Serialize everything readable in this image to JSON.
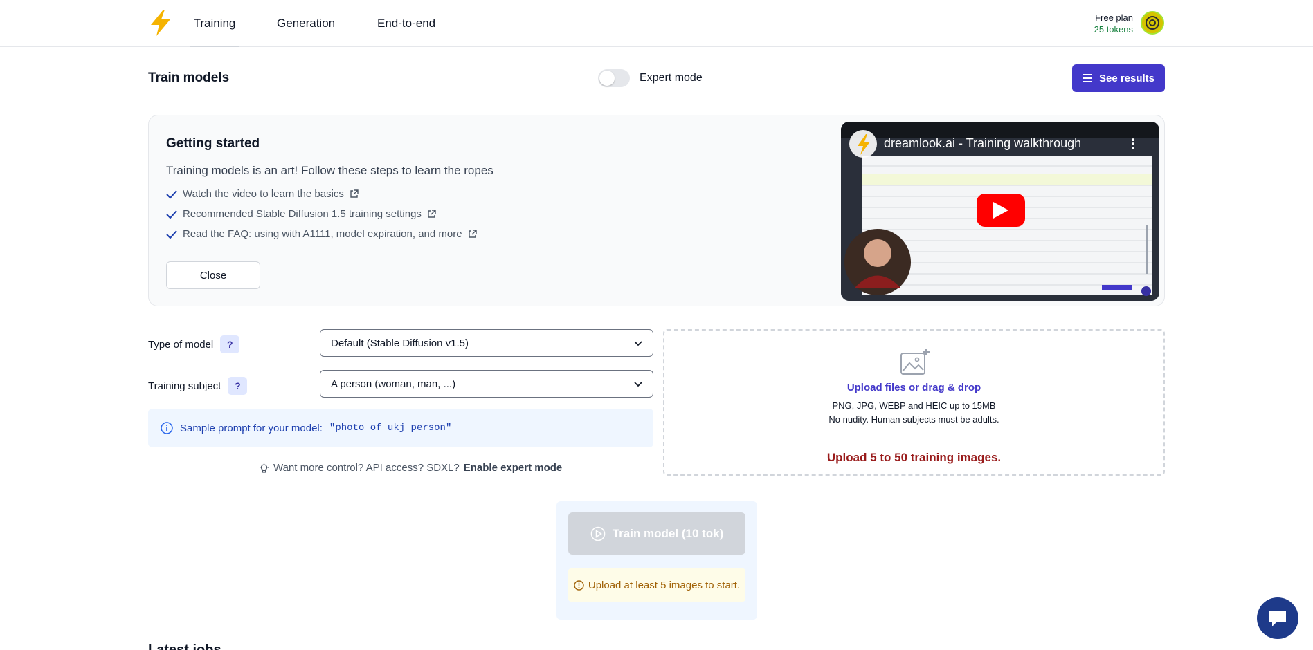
{
  "header": {
    "tabs": [
      {
        "label": "Training",
        "active": true
      },
      {
        "label": "Generation",
        "active": false
      },
      {
        "label": "End-to-end",
        "active": false
      }
    ],
    "plan_name": "Free plan",
    "plan_tokens": "25 tokens"
  },
  "page": {
    "title": "Train models",
    "expert_mode_label": "Expert mode",
    "expert_mode_on": false,
    "see_results_label": "See results"
  },
  "getting_started": {
    "title": "Getting started",
    "subtitle": "Training models is an art! Follow these steps to learn the ropes",
    "steps": [
      "Watch the video to learn the basics",
      "Recommended Stable Diffusion 1.5 training settings",
      "Read the FAQ: using with A1111, model expiration, and more"
    ],
    "close_label": "Close",
    "video_title": "dreamlook.ai - Training walkthrough"
  },
  "form": {
    "type_of_model_label": "Type of model",
    "type_of_model_value": "Default (Stable Diffusion v1.5)",
    "training_subject_label": "Training subject",
    "training_subject_value": "A person (woman, man, ...)",
    "help_label": "?",
    "sample_prompt_prefix": "Sample prompt for your model:",
    "sample_prompt": "\"photo of ukj person\"",
    "expert_hint": "Want more control? API access? SDXL?",
    "expert_hint_link": "Enable expert mode"
  },
  "upload": {
    "link_label": "Upload files or drag & drop",
    "formats": "PNG, JPG, WEBP and HEIC up to 15MB",
    "rule": "No nudity. Human subjects must be adults.",
    "requirement": "Upload 5 to 50 training images."
  },
  "train": {
    "button_label": "Train model (10 tok)",
    "warning": "Upload at least 5 images to start."
  },
  "latest_jobs_title": "Latest jobs",
  "colors": {
    "accent": "#4338ca",
    "error": "#991b1b",
    "warning": "#a16207",
    "tokens_green": "#15803d"
  }
}
